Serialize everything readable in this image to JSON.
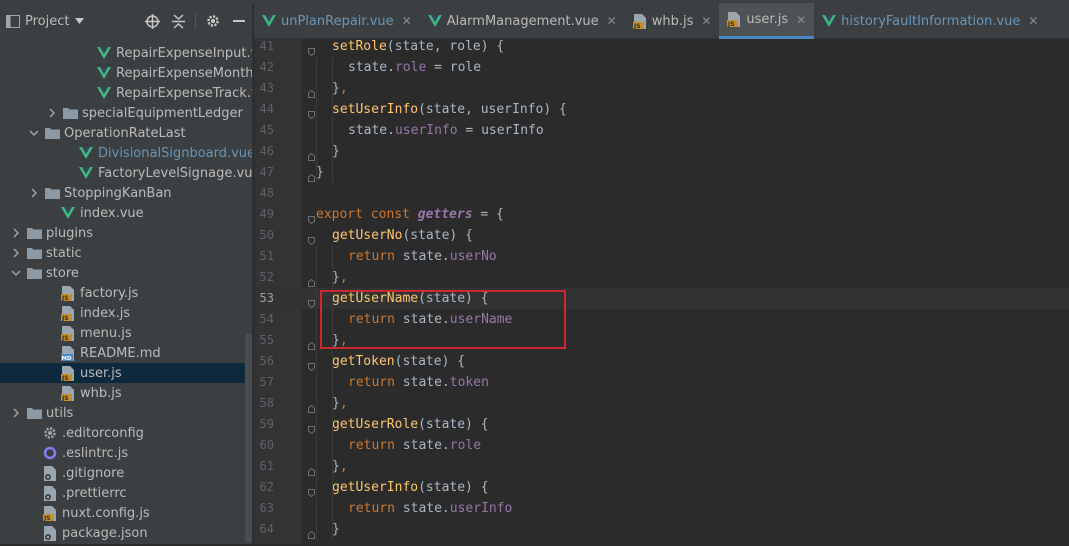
{
  "panel": {
    "title": "Project",
    "tree": [
      {
        "label": "RepairExpenseInput.vue",
        "type": "vue",
        "indent": 96,
        "arrow": ""
      },
      {
        "label": "RepairExpenseMonth.vue",
        "type": "vue",
        "indent": 96,
        "arrow": ""
      },
      {
        "label": "RepairExpenseTrack.vue",
        "type": "vue",
        "indent": 96,
        "arrow": ""
      },
      {
        "label": "specialEquipmentLedger",
        "type": "folder",
        "indent": 62,
        "arrow": "right"
      },
      {
        "label": "OperationRateLast",
        "type": "folder",
        "indent": 44,
        "arrow": "down"
      },
      {
        "label": "DivisionalSignboard.vue",
        "type": "vue-link",
        "indent": 78,
        "arrow": ""
      },
      {
        "label": "FactoryLevelSignage.vue",
        "type": "vue",
        "indent": 78,
        "arrow": ""
      },
      {
        "label": "StoppingKanBan",
        "type": "folder",
        "indent": 44,
        "arrow": "right"
      },
      {
        "label": "index.vue",
        "type": "vue",
        "indent": 60,
        "arrow": ""
      },
      {
        "label": "plugins",
        "type": "folder",
        "indent": 26,
        "arrow": "right"
      },
      {
        "label": "static",
        "type": "folder",
        "indent": 26,
        "arrow": "right"
      },
      {
        "label": "store",
        "type": "folder",
        "indent": 26,
        "arrow": "down"
      },
      {
        "label": "factory.js",
        "type": "js",
        "indent": 60,
        "arrow": ""
      },
      {
        "label": "index.js",
        "type": "js",
        "indent": 60,
        "arrow": ""
      },
      {
        "label": "menu.js",
        "type": "js",
        "indent": 60,
        "arrow": ""
      },
      {
        "label": "README.md",
        "type": "md",
        "indent": 60,
        "arrow": ""
      },
      {
        "label": "user.js",
        "type": "js",
        "indent": 60,
        "arrow": "",
        "selected": true
      },
      {
        "label": "whb.js",
        "type": "js",
        "indent": 60,
        "arrow": ""
      },
      {
        "label": "utils",
        "type": "folder",
        "indent": 26,
        "arrow": "right"
      },
      {
        "label": ".editorconfig",
        "type": "gear",
        "indent": 42,
        "arrow": ""
      },
      {
        "label": ".eslintrc.js",
        "type": "eslint",
        "indent": 42,
        "arrow": ""
      },
      {
        "label": ".gitignore",
        "type": "config",
        "indent": 42,
        "arrow": ""
      },
      {
        "label": ".prettierrc",
        "type": "config",
        "indent": 42,
        "arrow": ""
      },
      {
        "label": "nuxt.config.js",
        "type": "js",
        "indent": 42,
        "arrow": ""
      },
      {
        "label": "package.json",
        "type": "config",
        "indent": 42,
        "arrow": ""
      }
    ]
  },
  "tabs": [
    {
      "label": "unPlanRepair.vue",
      "type": "vue",
      "active": false
    },
    {
      "label": "AlarmManagement.vue",
      "type": "vue-plain",
      "active": false
    },
    {
      "label": "whb.js",
      "type": "js",
      "active": false
    },
    {
      "label": "user.js",
      "type": "js",
      "active": true
    },
    {
      "label": "historyFaultInformation.vue",
      "type": "vue",
      "active": false
    }
  ],
  "editor": {
    "current_line": 53,
    "lines": [
      {
        "n": "41",
        "indent": 1,
        "tokens": [
          [
            "fn",
            "setRole"
          ],
          [
            "plain",
            "(state, role) {"
          ]
        ]
      },
      {
        "n": "42",
        "indent": 2,
        "tokens": [
          [
            "plain",
            "state."
          ],
          [
            "prop",
            "role"
          ],
          [
            "plain",
            " = role"
          ]
        ]
      },
      {
        "n": "43",
        "indent": 1,
        "tokens": [
          [
            "plain",
            "}"
          ],
          [
            "kw",
            ","
          ]
        ]
      },
      {
        "n": "44",
        "indent": 1,
        "tokens": [
          [
            "fn",
            "setUserInfo"
          ],
          [
            "plain",
            "(state, userInfo) {"
          ]
        ]
      },
      {
        "n": "45",
        "indent": 2,
        "tokens": [
          [
            "plain",
            "state."
          ],
          [
            "prop",
            "userInfo"
          ],
          [
            "plain",
            " = userInfo"
          ]
        ]
      },
      {
        "n": "46",
        "indent": 1,
        "tokens": [
          [
            "plain",
            "}"
          ]
        ]
      },
      {
        "n": "47",
        "indent": 0,
        "tokens": [
          [
            "plain",
            "}"
          ]
        ]
      },
      {
        "n": "48",
        "indent": 0,
        "tokens": []
      },
      {
        "n": "49",
        "indent": 0,
        "tokens": [
          [
            "kw",
            "export const "
          ],
          [
            "ital",
            "getters"
          ],
          [
            "plain",
            " = {"
          ]
        ]
      },
      {
        "n": "50",
        "indent": 1,
        "tokens": [
          [
            "fn",
            "getUserNo"
          ],
          [
            "plain",
            "(state) {"
          ]
        ]
      },
      {
        "n": "51",
        "indent": 2,
        "tokens": [
          [
            "kw",
            "return "
          ],
          [
            "plain",
            "state."
          ],
          [
            "prop",
            "userNo"
          ]
        ]
      },
      {
        "n": "52",
        "indent": 1,
        "tokens": [
          [
            "plain",
            "}"
          ],
          [
            "kw",
            ","
          ]
        ]
      },
      {
        "n": "53",
        "indent": 1,
        "tokens": [
          [
            "fn",
            "getUserName"
          ],
          [
            "plain",
            "(state) {"
          ]
        ]
      },
      {
        "n": "54",
        "indent": 2,
        "tokens": [
          [
            "kw",
            "return "
          ],
          [
            "plain",
            "state."
          ],
          [
            "prop",
            "userName"
          ]
        ]
      },
      {
        "n": "55",
        "indent": 1,
        "tokens": [
          [
            "plain",
            "}"
          ],
          [
            "kw",
            ","
          ]
        ]
      },
      {
        "n": "56",
        "indent": 1,
        "tokens": [
          [
            "fn",
            "getToken"
          ],
          [
            "plain",
            "(state) {"
          ]
        ]
      },
      {
        "n": "57",
        "indent": 2,
        "tokens": [
          [
            "kw",
            "return "
          ],
          [
            "plain",
            "state."
          ],
          [
            "prop",
            "token"
          ]
        ]
      },
      {
        "n": "58",
        "indent": 1,
        "tokens": [
          [
            "plain",
            "}"
          ],
          [
            "kw",
            ","
          ]
        ]
      },
      {
        "n": "59",
        "indent": 1,
        "tokens": [
          [
            "fn",
            "getUserRole"
          ],
          [
            "plain",
            "(state) {"
          ]
        ]
      },
      {
        "n": "60",
        "indent": 2,
        "tokens": [
          [
            "kw",
            "return "
          ],
          [
            "plain",
            "state."
          ],
          [
            "prop",
            "role"
          ]
        ]
      },
      {
        "n": "61",
        "indent": 1,
        "tokens": [
          [
            "plain",
            "}"
          ],
          [
            "kw",
            ","
          ]
        ]
      },
      {
        "n": "62",
        "indent": 1,
        "tokens": [
          [
            "fn",
            "getUserInfo"
          ],
          [
            "plain",
            "(state) {"
          ]
        ]
      },
      {
        "n": "63",
        "indent": 2,
        "tokens": [
          [
            "kw",
            "return "
          ],
          [
            "plain",
            "state."
          ],
          [
            "prop",
            "userInfo"
          ]
        ]
      },
      {
        "n": "64",
        "indent": 1,
        "tokens": [
          [
            "plain",
            "}"
          ]
        ]
      }
    ]
  },
  "colors": {
    "accent": "#4a88c7",
    "vue_green": "#41b883",
    "highlight_box": "#d0282e",
    "selection": "#0d293e"
  }
}
